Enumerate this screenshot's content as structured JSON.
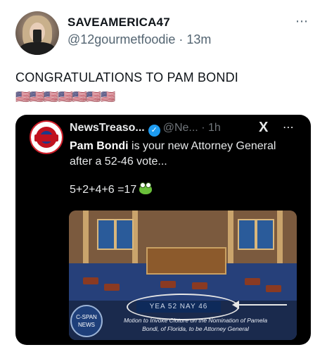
{
  "post": {
    "display_name": "SAVEAMERICA47",
    "handle": "@12gourmetfoodie",
    "separator": "·",
    "time": "13m",
    "text": "CONGRATULATIONS TO PAM BONDI",
    "flags": "🇺🇸🇺🇸🇺🇸🇺🇸🇺🇸🇺🇸🇺🇸"
  },
  "quote": {
    "name": "NewsTreaso...",
    "handle": "@Ne...",
    "separator": "·",
    "time": "1h",
    "body_bold": "Pam Bondi",
    "body_rest": " is your new Attorney General after a 52-46 vote...",
    "math": "5+2+4+6 =17",
    "media": {
      "vote_text": "YEA 52   NAY 46",
      "caption": "Motion to Invoke Cloture on the Nomination of Pamela Bondi, of Florida, to be Attorney General",
      "logo_text": "C-SPAN NEWS"
    }
  },
  "icons": {
    "more": "⋯",
    "verified": "✓",
    "x_logo": "X"
  }
}
